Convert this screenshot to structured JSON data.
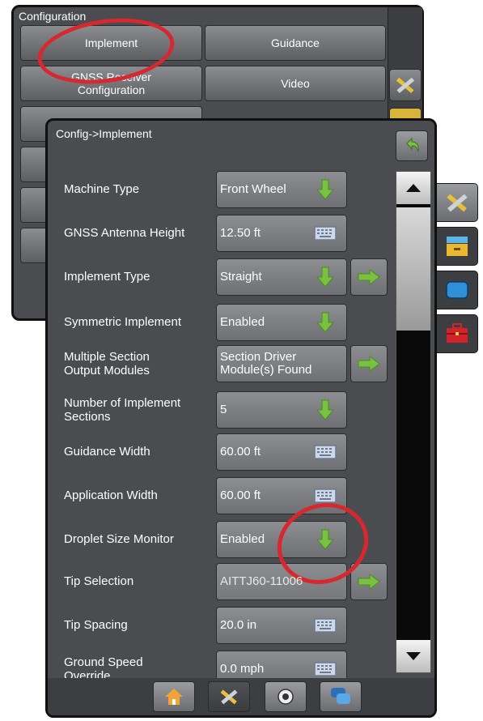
{
  "back_panel": {
    "title": "Configuration",
    "buttons": [
      "Implement",
      "Guidance",
      "GNSS Receiver\nConfiguration",
      "Video"
    ]
  },
  "front_panel": {
    "title": "Config->Implement",
    "rows": [
      {
        "label": "Machine Type",
        "value": "Front Wheel",
        "control": "arrow-down"
      },
      {
        "label": "GNSS Antenna Height",
        "value": "12.50 ft",
        "control": "keyboard"
      },
      {
        "label": "Implement Type",
        "value": "Straight",
        "control": "arrow-down",
        "extra": "arrow-right"
      },
      {
        "label": "Symmetric Implement",
        "value": "Enabled",
        "control": "arrow-down"
      },
      {
        "label": "Multiple Section Output Modules",
        "value": "Section Driver Module(s) Found",
        "control": "arrow-right-inline"
      },
      {
        "label": "Number of Implement Sections",
        "value": "5",
        "control": "arrow-down"
      },
      {
        "label": "Guidance Width",
        "value": "60.00 ft",
        "control": "keyboard"
      },
      {
        "label": "Application Width",
        "value": "60.00 ft",
        "control": "keyboard"
      },
      {
        "label": "Droplet Size Monitor",
        "value": "Enabled",
        "control": "arrow-down"
      },
      {
        "label": "Tip Selection",
        "value": "AITTJ60-11006",
        "control": "none",
        "extra": "arrow-right"
      },
      {
        "label": "Tip Spacing",
        "value": "20.0 in",
        "control": "keyboard"
      },
      {
        "label": "Ground Speed Override",
        "value": "0.0 mph",
        "control": "keyboard"
      }
    ]
  },
  "side_tabs": [
    "tools-icon",
    "console-icon",
    "screen-icon",
    "toolbox-icon"
  ],
  "bottom_nav": [
    "home-icon",
    "tools-icon",
    "camera-icon",
    "chat-icon"
  ],
  "colors": {
    "arrow_green": "#7ac143",
    "highlight_red": "#d8272e",
    "panel_bg": "#4a4c4f"
  }
}
